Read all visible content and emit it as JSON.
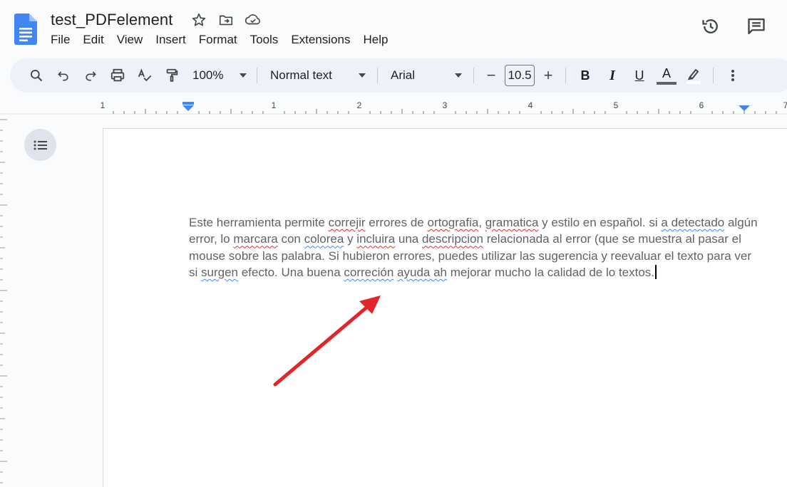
{
  "document": {
    "title": "test_PDFelement"
  },
  "menu": [
    "File",
    "Edit",
    "View",
    "Insert",
    "Format",
    "Tools",
    "Extensions",
    "Help"
  ],
  "title_icons": [
    "star-icon",
    "move-folder-icon",
    "cloud-saved-icon"
  ],
  "header_right_icons": [
    "version-history-icon",
    "comments-icon"
  ],
  "toolbar": {
    "zoom": "100%",
    "style": "Normal text",
    "font": "Arial",
    "font_size": "10.5",
    "minus": "−",
    "plus": "+",
    "bold": "B",
    "italic": "I",
    "underline": "U",
    "text_color": "A"
  },
  "ruler": {
    "labels": [
      "1",
      "1",
      "2",
      "3",
      "4",
      "5",
      "6",
      "7"
    ]
  },
  "body": {
    "s1": "Este herramienta permite ",
    "w1": "correjir",
    "s2": " errores de ",
    "w2": "ortografia",
    "s3": ", ",
    "w3": "gramatica",
    "s4": " y estilo en español. si ",
    "w4": "a detectado",
    "s5": " algún error, lo ",
    "w5": "marcara",
    "s6": " con ",
    "w6": "colorea",
    "s7": " y ",
    "w7": "incluira",
    "s8": " una ",
    "w8": "descripcion",
    "s9": " relacionada al error (que se muestra al pasar el mouse sobre las palabra. Si hubieron errores, puedes utilizar las sugerencia y reevaluar el texto para ver si ",
    "w9": "surgen",
    "s10": " efecto. Una buena ",
    "w10": "correción",
    "s11": " ",
    "w11": "ayuda ah",
    "s12": " mejorar mucho la calidad de lo textos."
  },
  "colors": {
    "accent_blue": "#4285f4",
    "toolbar_bg": "#edf2fa",
    "spell_error": "#d93025",
    "grammar_error": "#4285f4",
    "annotation_arrow": "#e0252b"
  }
}
